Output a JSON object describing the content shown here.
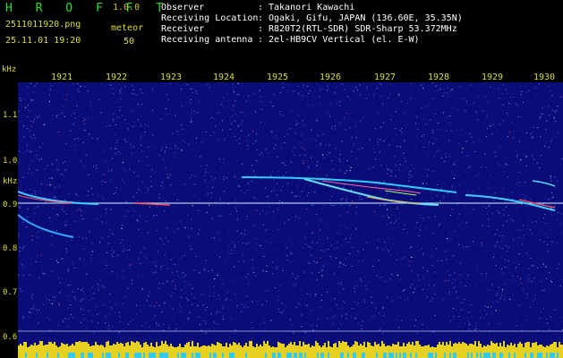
{
  "app": {
    "title": "H R O F F T",
    "version": "1.0.0"
  },
  "capture": {
    "file_name": "2511011920.png",
    "date_time": "25.11.01 19:20",
    "meteor_label": "meteor",
    "meteor_count": "50"
  },
  "info": [
    {
      "label": "Observer",
      "value": "Takanori Kawachi"
    },
    {
      "label": "Receiving Location",
      "value": "Ogaki, Gifu, JAPAN (136.60E, 35.35N)"
    },
    {
      "label": "Receiver",
      "value": "R820T2(RTL-SDR) SDR-Sharp 53.372MHz"
    },
    {
      "label": "Receiving antenna",
      "value": "2el-HB9CV Vertical (el. E-W)"
    }
  ],
  "axis": {
    "freq_unit": "kHz",
    "time_ticks": [
      "1921",
      "1922",
      "1923",
      "1924",
      "1925",
      "1926",
      "1927",
      "1928",
      "1929",
      "1930"
    ],
    "freq_ticks": [
      "1.1",
      "1.0",
      "0.9",
      "0.8",
      "0.7",
      "0.6"
    ],
    "freq_unit_mid": "kHz"
  },
  "colors": {
    "background": "#0a0c78",
    "label_yellow": "#dddd33",
    "title_green": "#22dd22"
  }
}
